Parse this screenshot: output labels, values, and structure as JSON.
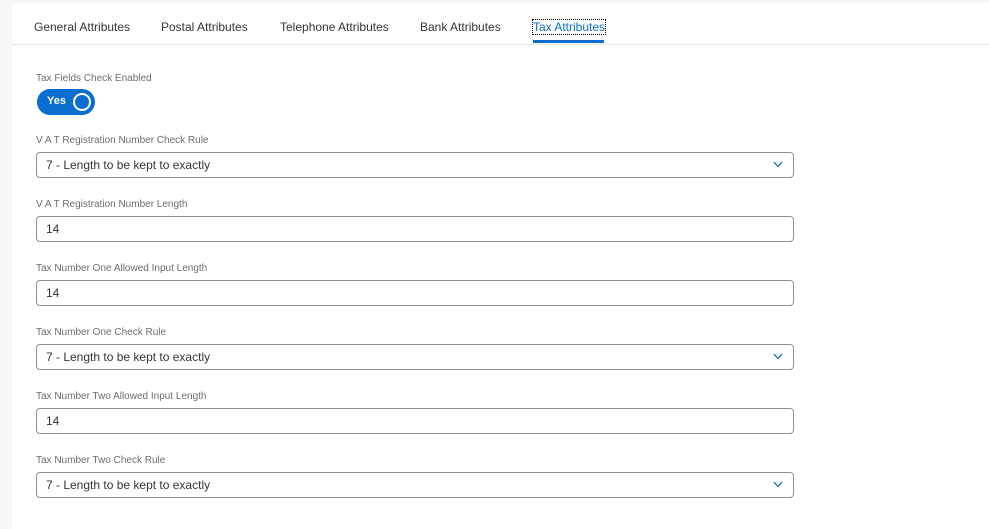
{
  "tabs": [
    {
      "label": "General Attributes"
    },
    {
      "label": "Postal Attributes"
    },
    {
      "label": "Telephone Attributes"
    },
    {
      "label": "Bank Attributes"
    },
    {
      "label": "Tax Attributes",
      "active": true
    }
  ],
  "colors": {
    "accent": "#0a6ed1",
    "label": "#6a6d70",
    "text": "#32363a",
    "border": "#89919a"
  },
  "form": {
    "tax_fields_check": {
      "label": "Tax Fields Check Enabled",
      "value": "Yes"
    },
    "vat_check_rule": {
      "label": "V A T Registration Number Check Rule",
      "value": "7 - Length to be kept to exactly",
      "icon": "chevron-down-icon"
    },
    "vat_length": {
      "label": "V A T Registration Number Length",
      "value": "14"
    },
    "tax1_length": {
      "label": "Tax Number One Allowed Input Length",
      "value": "14"
    },
    "tax1_check_rule": {
      "label": "Tax Number One Check Rule",
      "value": "7 - Length to be kept to exactly",
      "icon": "chevron-down-icon"
    },
    "tax2_length": {
      "label": "Tax Number Two Allowed Input Length",
      "value": "14"
    },
    "tax2_check_rule": {
      "label": "Tax Number Two Check Rule",
      "value": "7 - Length to be kept to exactly",
      "icon": "chevron-down-icon"
    }
  }
}
